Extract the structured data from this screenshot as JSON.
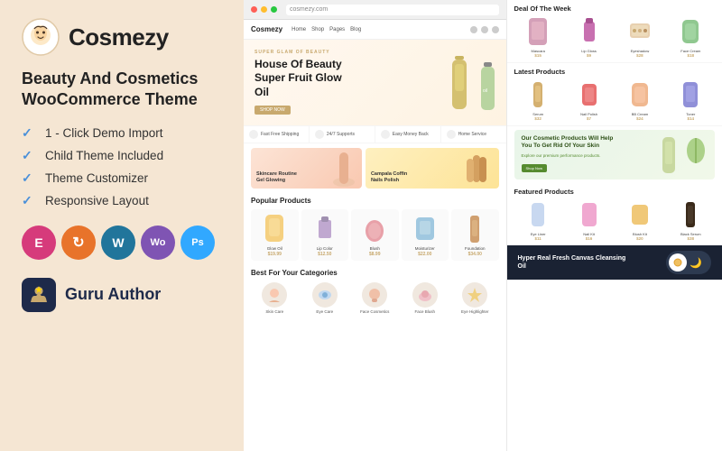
{
  "theme": {
    "name": "Cosmezy",
    "tagline_line1": "Beauty And Cosmetics",
    "tagline_line2": "WooCommerce Theme"
  },
  "features": [
    {
      "label": "1 - Click Demo Import"
    },
    {
      "label": "Child Theme Included"
    },
    {
      "label": "Theme Customizer"
    },
    {
      "label": "Responsive Layout"
    }
  ],
  "tech_badges": [
    {
      "letter": "E",
      "class": "badge-elementor",
      "name": "Elementor"
    },
    {
      "letter": "↻",
      "class": "badge-update",
      "name": "Updates"
    },
    {
      "letter": "W",
      "class": "badge-wp",
      "name": "WordPress"
    },
    {
      "letter": "Wo",
      "class": "badge-woo",
      "name": "WooCommerce"
    },
    {
      "letter": "Ps",
      "class": "badge-ps",
      "name": "Photoshop"
    }
  ],
  "author": {
    "label": "Guru Author",
    "icon": "⭐"
  },
  "site": {
    "logo": "Cosmezy",
    "hero": {
      "super": "SUPER GLAM OF BEAUTY",
      "title": "House Of Beauty Super Fruit Glow Oil",
      "cta": "SHOP NOW"
    },
    "banner_features": [
      {
        "text": "Fast Free Shipping"
      },
      {
        "text": "24/7 Supports"
      },
      {
        "text": "Easy Money Back"
      },
      {
        "text": "Home Service"
      }
    ],
    "promo_cards": [
      {
        "title": "Skincare Routine\nGel Glowing"
      },
      {
        "title": "Campala Coffin\nNails Polish"
      }
    ],
    "sections": {
      "popular": "Popular Products",
      "categories": "Best For Your Categories",
      "deal": "Deal Of The Week",
      "latest": "Latest Products",
      "featured": "Featured Products",
      "dark_title": "Hyper Real Fresh Canvas Cleansing Oil"
    },
    "categories": [
      {
        "name": "Skin Care"
      },
      {
        "name": "Eye Care"
      },
      {
        "name": "Face Cosmetics"
      },
      {
        "name": "Face Blush"
      },
      {
        "name": "Eye Highlighter"
      }
    ]
  }
}
